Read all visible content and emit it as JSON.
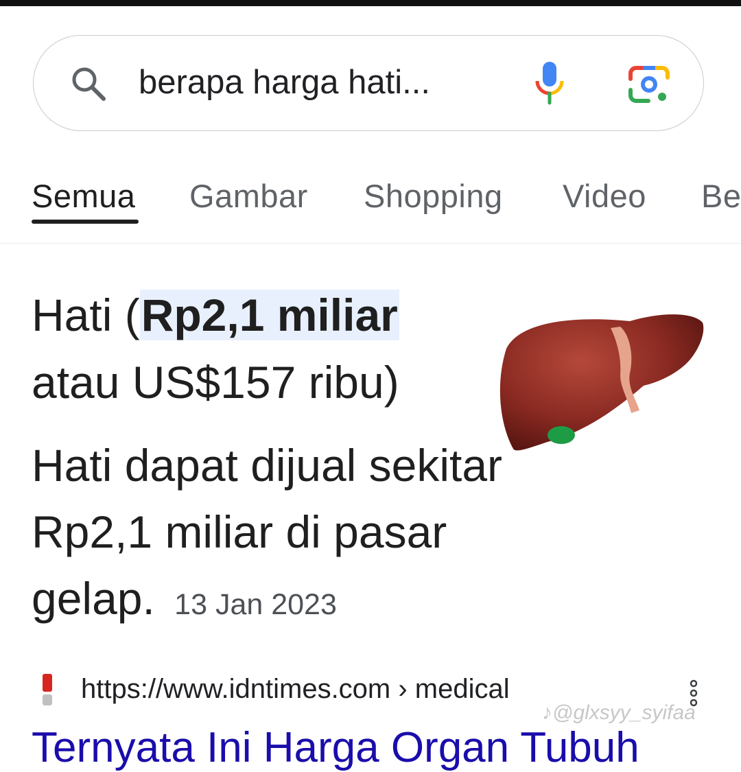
{
  "search": {
    "query": "berapa harga hati..."
  },
  "tabs": [
    {
      "label": "Semua",
      "active": true
    },
    {
      "label": "Gambar",
      "active": false
    },
    {
      "label": "Shopping",
      "active": false
    },
    {
      "label": "Video",
      "active": false
    },
    {
      "label": "Be",
      "active": false
    }
  ],
  "answer": {
    "headline_prefix": "Hati (",
    "headline_highlight": "Rp2,1 miliar",
    "headline_suffix": "atau US$157 ribu)",
    "snippet": "Hati dapat dijual sekitar Rp2,1 miliar di pasar gelap.",
    "date": "13 Jan 2023",
    "image_icon": "liver-image"
  },
  "source": {
    "url": "https://www.idntimes.com › medical",
    "favicon": "idntimes-favicon",
    "title": "Ternyata Ini Harga Organ Tubuh"
  },
  "watermark": "♪@glxsyy_syifaa",
  "colors": {
    "link": "#1a0dab",
    "highlight": "#e8f0fe",
    "tab_inactive": "#5f6368"
  }
}
